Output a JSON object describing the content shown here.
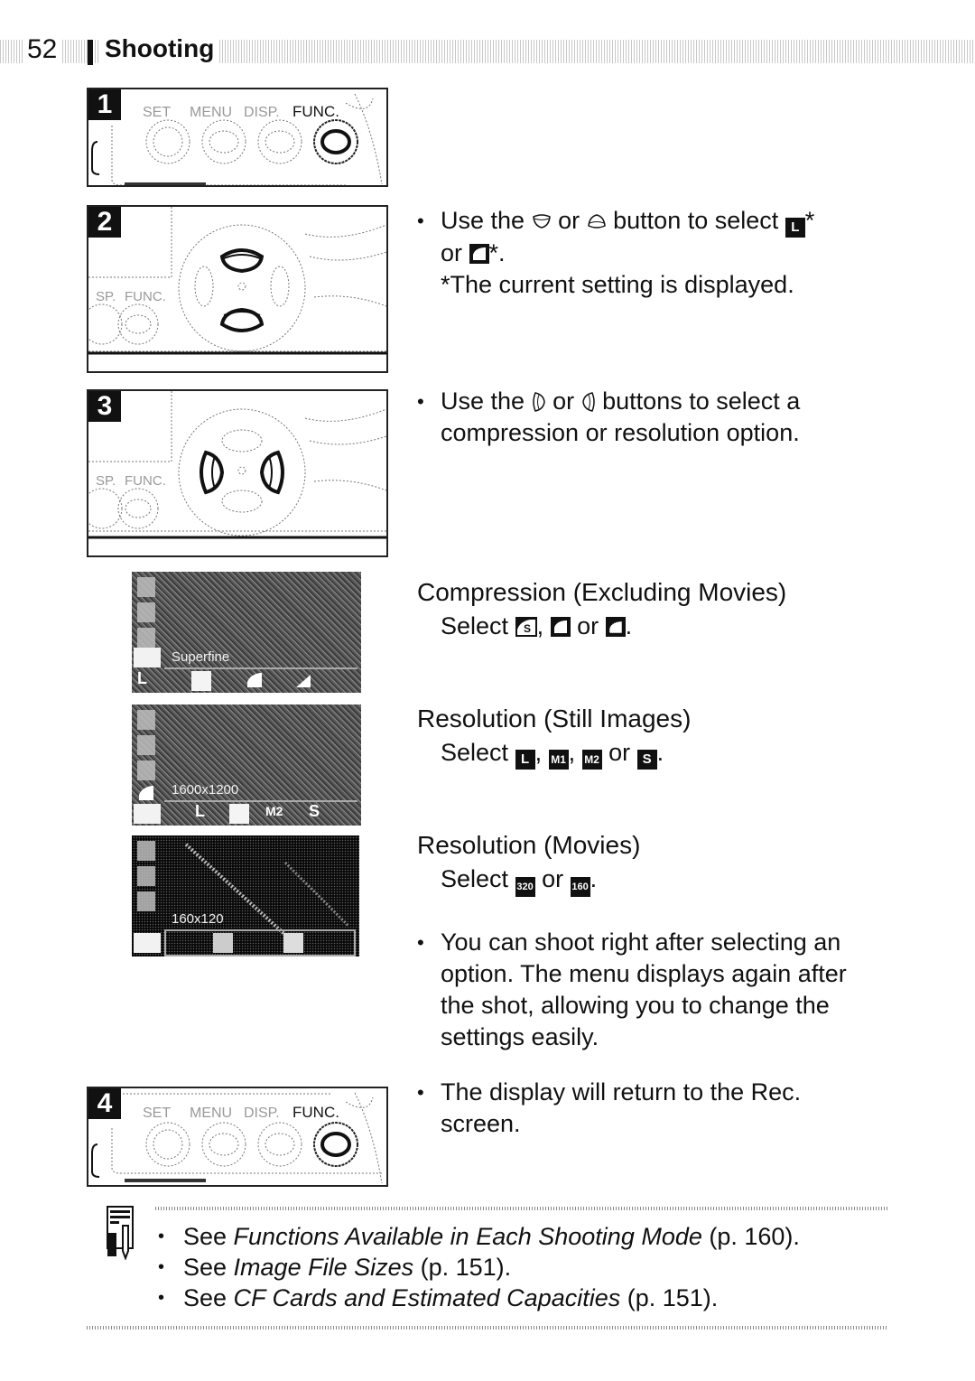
{
  "header": {
    "page_number": "52",
    "section_title": "Shooting"
  },
  "steps": [
    {
      "number": "1",
      "illustration": "camera-buttons-func-highlighted",
      "button_labels": [
        "SET",
        "MENU",
        "DISP.",
        "FUNC."
      ]
    },
    {
      "number": "2",
      "illustration": "control-dial-up-down-highlighted",
      "labels": [
        "SP.",
        "FUNC."
      ],
      "text": {
        "pre": "Use the",
        "icon1": "down-button-icon",
        "mid1": "or",
        "icon2": "up-button-icon",
        "mid2": "button to select",
        "icon3_label": "L",
        "icon3": "resolution-large-icon",
        "star1": "*",
        "line2_or": "or",
        "icon4": "compression-fine-icon",
        "star2": "*.",
        "footnote": "*The current setting is displayed."
      }
    },
    {
      "number": "3",
      "illustration": "control-dial-left-right-highlighted",
      "labels": [
        "SP.",
        "FUNC."
      ],
      "text": {
        "pre": "Use the",
        "icon1": "left-button-icon",
        "mid1": "or",
        "icon2": "right-button-icon",
        "rest_line1": "buttons to select a",
        "line2": "compression or resolution option."
      }
    },
    {
      "number": "4",
      "illustration": "camera-buttons-func-highlighted",
      "button_labels": [
        "SET",
        "MENU",
        "DISP.",
        "FUNC."
      ],
      "text": {
        "line1": "The display will return to the Rec.",
        "line2": "screen."
      }
    }
  ],
  "lcd_screens": [
    {
      "name": "compression-menu-screen",
      "label": "Superfine",
      "options": [
        "L",
        "",
        "",
        "",
        ""
      ]
    },
    {
      "name": "resolution-still-menu-screen",
      "label": "1600x1200",
      "options": [
        "L",
        "",
        "M2",
        "S",
        ""
      ]
    },
    {
      "name": "resolution-movie-menu-screen",
      "label": "160x120",
      "options": [
        "",
        "",
        "",
        "",
        ""
      ]
    }
  ],
  "sections": {
    "compression": {
      "heading": "Compression (Excluding Movies)",
      "select_label": "Select",
      "icon1": "S",
      "sep1": ",",
      "or": "or",
      "end": "."
    },
    "resolution_still": {
      "heading": "Resolution (Still Images)",
      "select_label": "Select",
      "icon1": "L",
      "icon2": "M1",
      "icon3": "M2",
      "icon4": "S",
      "sep": ",",
      "or": "or",
      "end": "."
    },
    "resolution_movies": {
      "heading": "Resolution (Movies)",
      "select_label": "Select",
      "icon1": "320",
      "icon2": "160",
      "or": "or",
      "end": "."
    },
    "shoot_note": [
      "You can shoot right after selecting an",
      "option. The menu displays again after",
      "the shot, allowing you to change the",
      "settings easily."
    ]
  },
  "notes": {
    "icon": "memo-pencil-icon",
    "items": [
      {
        "prefix": "See ",
        "title": "Functions Available in Each Shooting Mode",
        "suffix": " (p. 160)."
      },
      {
        "prefix": "See ",
        "title": "Image File Sizes",
        "suffix": " (p. 151)."
      },
      {
        "prefix": "See ",
        "title": "CF Cards and Estimated Capacities",
        "suffix": " (p. 151)."
      }
    ]
  }
}
